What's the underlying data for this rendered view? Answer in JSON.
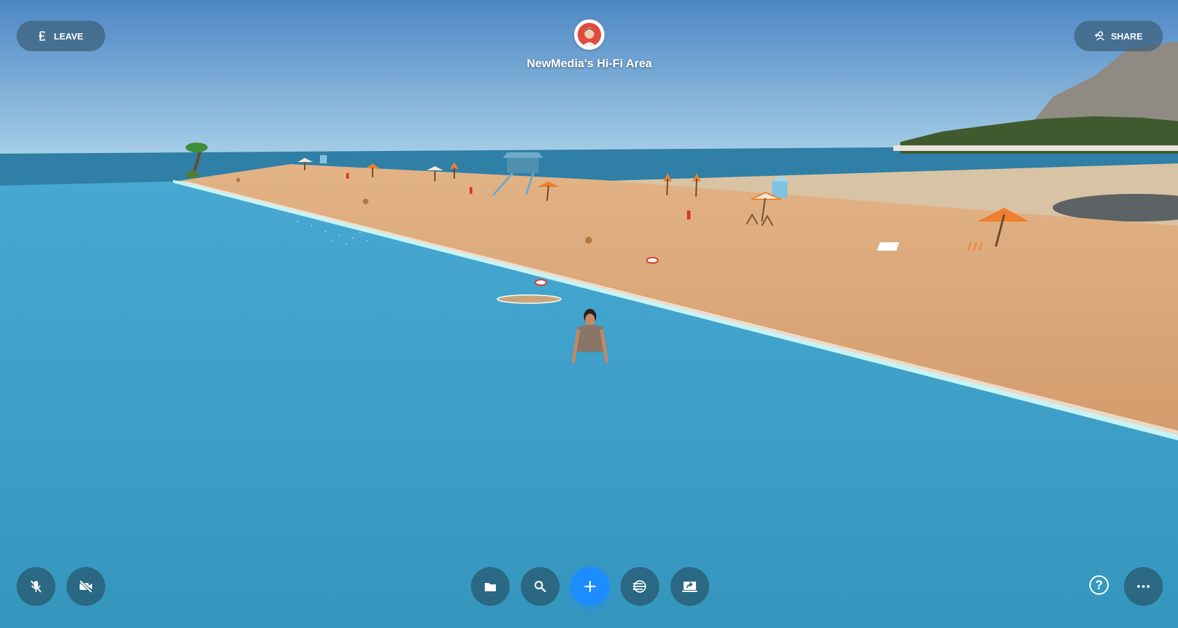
{
  "top_bar": {
    "leave_label": "LEAVE",
    "share_label": "SHARE",
    "room_title": "NewMedia's Hi-Fi Area"
  },
  "icons": {
    "leave": "leave-icon",
    "share": "add-person-icon",
    "avatar": "user-avatar",
    "mic": "mic-off-icon",
    "camera": "camera-off-icon",
    "files": "folder-icon",
    "search": "search-icon",
    "add": "plus-icon",
    "audio": "spatial-audio-icon",
    "screenshare": "screen-share-icon",
    "help": "question-icon",
    "more": "more-dots-icon"
  },
  "help": {
    "glyph": "?"
  },
  "colors": {
    "sky_top": "#4d87c4",
    "sky_bottom": "#a5cce6",
    "sea_far": "#2f7fa6",
    "water": "#3aa0c8",
    "sand": "#dca678",
    "sand_far": "#d9c3a5",
    "foam": "#bff0f4",
    "accent": "#1d8cff",
    "button_bg": "#3c5f78"
  }
}
